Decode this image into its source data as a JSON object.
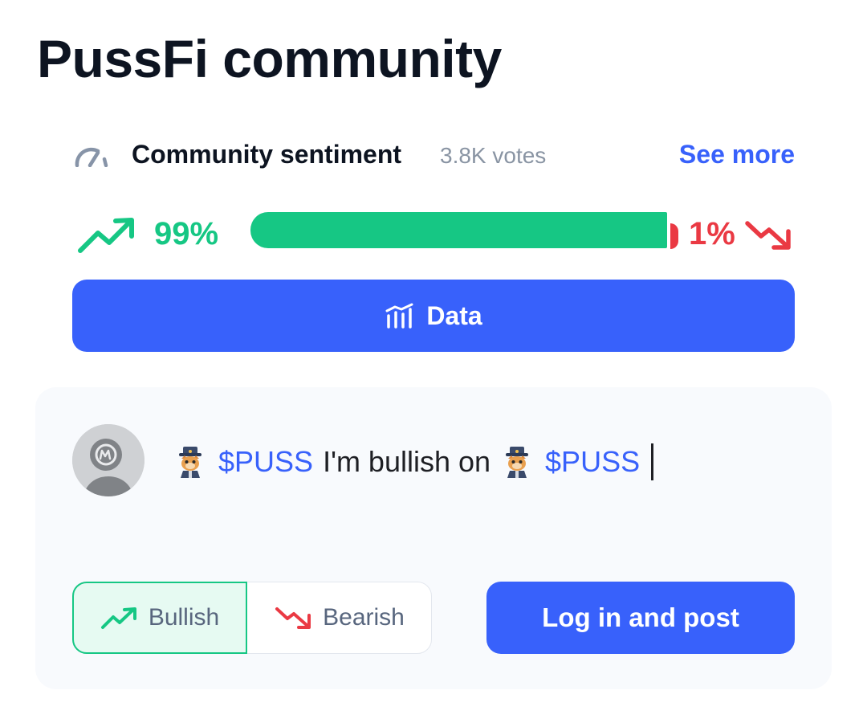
{
  "title": "PussFi community",
  "sentiment": {
    "icon": "gauge-icon",
    "label": "Community sentiment",
    "votes": "3.8K votes",
    "see_more": "See more",
    "bullish_pct": "99%",
    "bearish_pct": "1%",
    "bullish_fraction": 0.99,
    "bearish_fraction": 0.01,
    "colors": {
      "bullish": "#16c784",
      "bearish": "#ea3943"
    }
  },
  "data_button": {
    "label": "Data",
    "icon": "bar-chart-icon"
  },
  "composer": {
    "avatar_icon": "coinmarketcap-avatar-icon",
    "token_emoji": "cat-with-hat-emoji",
    "tag": "$PUSS",
    "text": "I'm bullish on",
    "toggle": {
      "bullish_label": "Bullish",
      "bearish_label": "Bearish",
      "selected": "bullish"
    },
    "post_button": "Log in and post"
  },
  "accent_color": "#3861fb"
}
